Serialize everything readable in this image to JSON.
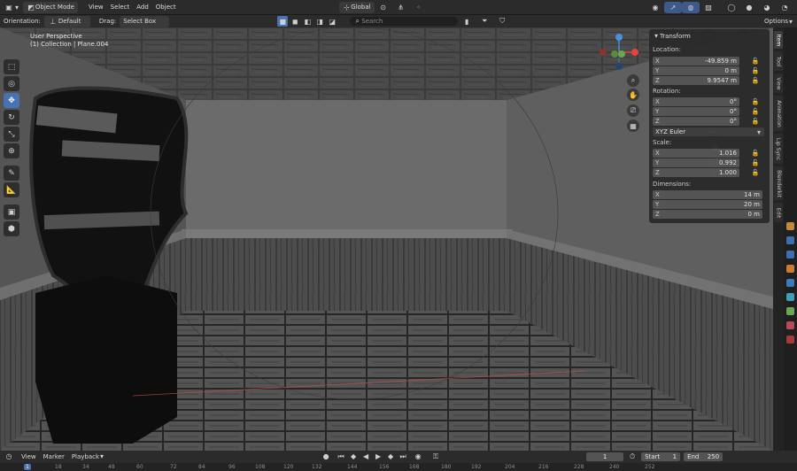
{
  "header": {
    "mode": "Object Mode",
    "menus": [
      "View",
      "Select",
      "Add",
      "Object"
    ],
    "transform_orientation": "Global",
    "options_label": "Options"
  },
  "toolbar": {
    "orientation_label": "Orientation:",
    "orientation_value": "Default",
    "drag_label": "Drag:",
    "drag_value": "Select Box",
    "search_placeholder": "Search"
  },
  "viewport": {
    "perspective": "User Perspective",
    "collection": "(1) Collection | Plane.004"
  },
  "npanel": {
    "section": "Transform",
    "location": {
      "label": "Location:",
      "x": "-49.859 m",
      "y": "0 m",
      "z": "9.9547 m"
    },
    "rotation": {
      "label": "Rotation:",
      "x": "0°",
      "y": "0°",
      "z": "0°",
      "mode": "XYZ Euler"
    },
    "scale": {
      "label": "Scale:",
      "x": "1.016",
      "y": "0.992",
      "z": "1.000"
    },
    "dimensions": {
      "label": "Dimensions:",
      "x": "14 m",
      "y": "20 m",
      "z": "0 m"
    },
    "axes": [
      "X",
      "Y",
      "Z"
    ]
  },
  "vtabs": [
    "Item",
    "Tool",
    "View",
    "Animation",
    "Lip Sync",
    "Blenderkit",
    "Edit"
  ],
  "timeline": {
    "menus": [
      "View",
      "Marker",
      "Playback"
    ],
    "current_frame": "1",
    "start_label": "Start",
    "start_value": "1",
    "end_label": "End",
    "end_value": "250",
    "ruler_ticks": [
      "1",
      "18",
      "34",
      "48",
      "60",
      "72",
      "84",
      "96",
      "108",
      "120",
      "132",
      "144",
      "156",
      "168",
      "180",
      "192",
      "204",
      "216",
      "228",
      "240",
      "252"
    ]
  },
  "colors": {
    "accent": "#4772b3",
    "x_axis": "#e5453c",
    "y_axis": "#6aa84f",
    "z_axis": "#4a8fe0"
  }
}
